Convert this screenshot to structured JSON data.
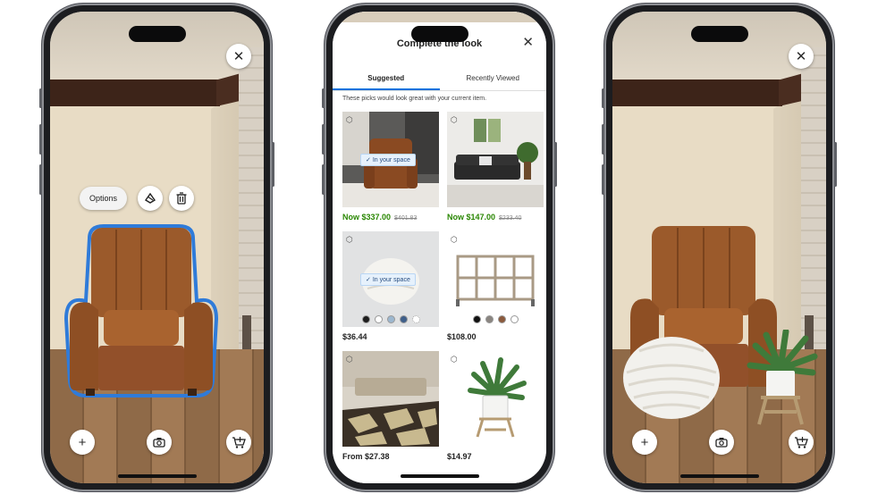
{
  "left_phone": {
    "options_label": "Options",
    "icons": [
      "close-icon",
      "rotate-icon",
      "trash-icon",
      "plus-icon",
      "camera-icon",
      "add-to-cart-icon"
    ]
  },
  "middle_phone": {
    "title": "Complete the look",
    "tabs": [
      {
        "label": "Suggested",
        "active": true
      },
      {
        "label": "Recently Viewed",
        "active": false
      }
    ],
    "hint": "These picks would look great with your current item.",
    "products": [
      {
        "name": "recliner",
        "badge": "In your space",
        "now_price": "Now $337.00",
        "was_price": "$401.83"
      },
      {
        "name": "futon",
        "badge": "",
        "now_price": "Now $147.00",
        "was_price": "$233.40"
      },
      {
        "name": "pouf",
        "badge": "In your space",
        "price": "$36.44",
        "swatch_colors": [
          "#1d1d1d",
          "#ffffff",
          "#9cb7cf",
          "#3f5f8a",
          "#ffffff"
        ]
      },
      {
        "name": "cube-shelf",
        "badge": "",
        "price": "$108.00",
        "swatch_colors": [
          "#111111",
          "#8a8580",
          "#8b5a3c",
          "#ffffff"
        ]
      },
      {
        "name": "rug",
        "badge": "",
        "price": "From $27.38"
      },
      {
        "name": "plant",
        "badge": "",
        "price": "$14.97"
      }
    ]
  },
  "right_phone": {
    "icons": [
      "close-icon",
      "plus-icon",
      "camera-icon",
      "add-to-cart-icon"
    ]
  },
  "colors": {
    "accent_blue": "#0071dc",
    "sale_green": "#2a8703",
    "selection_blue": "#2f7bd9"
  }
}
